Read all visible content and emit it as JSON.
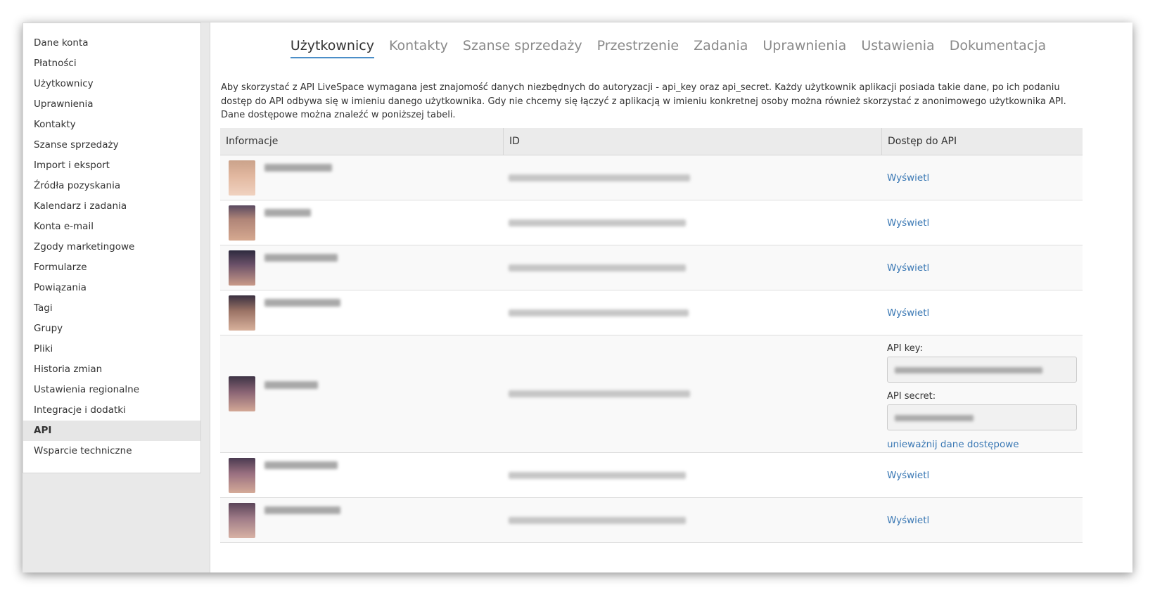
{
  "sidebar": {
    "items": [
      {
        "label": "Dane konta"
      },
      {
        "label": "Płatności"
      },
      {
        "label": "Użytkownicy"
      },
      {
        "label": "Uprawnienia"
      },
      {
        "label": "Kontakty"
      },
      {
        "label": "Szanse sprzedaży"
      },
      {
        "label": "Import i eksport"
      },
      {
        "label": "Źródła pozyskania"
      },
      {
        "label": "Kalendarz i zadania"
      },
      {
        "label": "Konta e-mail"
      },
      {
        "label": "Zgody marketingowe"
      },
      {
        "label": "Formularze"
      },
      {
        "label": "Powiązania"
      },
      {
        "label": "Tagi"
      },
      {
        "label": "Grupy"
      },
      {
        "label": "Pliki"
      },
      {
        "label": "Historia zmian"
      },
      {
        "label": "Ustawienia regionalne"
      },
      {
        "label": "Integracje i dodatki"
      },
      {
        "label": "API"
      },
      {
        "label": "Wsparcie techniczne"
      }
    ],
    "active_item": "API"
  },
  "tabs": [
    {
      "label": "Użytkownicy"
    },
    {
      "label": "Kontakty"
    },
    {
      "label": "Szanse sprzedaży"
    },
    {
      "label": "Przestrzenie"
    },
    {
      "label": "Zadania"
    },
    {
      "label": "Uprawnienia"
    },
    {
      "label": "Ustawienia"
    },
    {
      "label": "Dokumentacja"
    }
  ],
  "active_tab": "Użytkownicy",
  "intro": "Aby skorzystać z API LiveSpace wymagana jest znajomość danych niezbędnych do autoryzacji - api_key oraz api_secret. Każdy użytkownik aplikacji posiada takie dane, po ich podaniu dostęp do API odbywa się w imieniu danego użytkownika. Gdy nie chcemy się łączyć z aplikacją w imieniu konkretnej osoby można również skorzystać z anonimowego użytkownika API. Dane dostępowe można znaleźć w poniższej tabeli.",
  "table": {
    "headers": {
      "info": "Informacje",
      "id": "ID",
      "api": "Dostęp do API"
    },
    "show_label": "Wyświetl",
    "api_key_label": "API key:",
    "api_secret_label": "API secret:",
    "revoke_label": "unieważnij dane dostępowe"
  },
  "colors": {
    "link": "#3a78b4",
    "active_tab_underline": "#4b8ec8"
  }
}
